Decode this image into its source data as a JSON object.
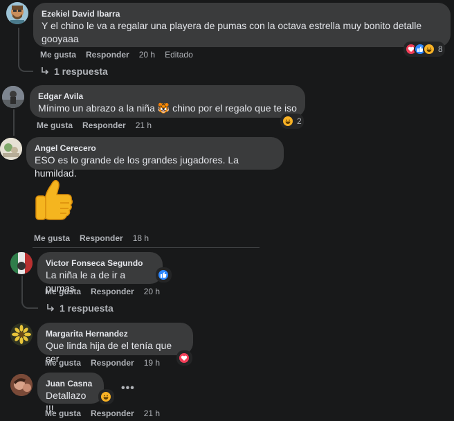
{
  "comments": [
    {
      "author": "Ezekiel David Ibarra",
      "text": "Y el chino le va a regalar una playera de pumas con la octava estrella muy bonito detalle gooyaaa",
      "like_label": "Me gusta",
      "reply_label": "Responder",
      "time": "20 h",
      "edited": "Editado",
      "reaction_count": "8",
      "reactions": [
        "love",
        "like",
        "haha"
      ],
      "replies_label": "1 respuesta"
    },
    {
      "author": "Edgar Avila",
      "text": "Mínimo un abrazo a la niña 🐯 chino por el regalo que te iso",
      "like_label": "Me gusta",
      "reply_label": "Responder",
      "time": "21 h",
      "reaction_count": "2",
      "reactions": [
        "haha"
      ]
    },
    {
      "author": "Angel Cerecero",
      "text": "ESO es lo grande de los grandes jugadores. La humildad.",
      "sticker": "thumbs-up",
      "like_label": "Me gusta",
      "reply_label": "Responder",
      "time": "18 h"
    },
    {
      "author": "Victor Fonseca Segundo",
      "text": "La niña le a de ir a pumas",
      "like_label": "Me gusta",
      "reply_label": "Responder",
      "time": "20 h",
      "reactions": [
        "like"
      ],
      "replies_label": "1 respuesta"
    },
    {
      "author": "Margarita Hernandez",
      "text": "Que linda hija de el tenía que ser",
      "like_label": "Me gusta",
      "reply_label": "Responder",
      "time": "19 h",
      "reactions": [
        "love"
      ]
    },
    {
      "author": "Juan Casna",
      "text": "Detallazo !!!",
      "like_label": "Me gusta",
      "reply_label": "Responder",
      "time": "21 h",
      "reactions": [
        "haha"
      ],
      "more_label": "•••"
    }
  ],
  "colors": {
    "background": "#18191a",
    "bubble": "#3a3b3c",
    "secondary_text": "#b0b3b8",
    "like_blue": "#2d88ff",
    "love_red": "#f33e58",
    "haha_yellow": "#f7b125"
  }
}
